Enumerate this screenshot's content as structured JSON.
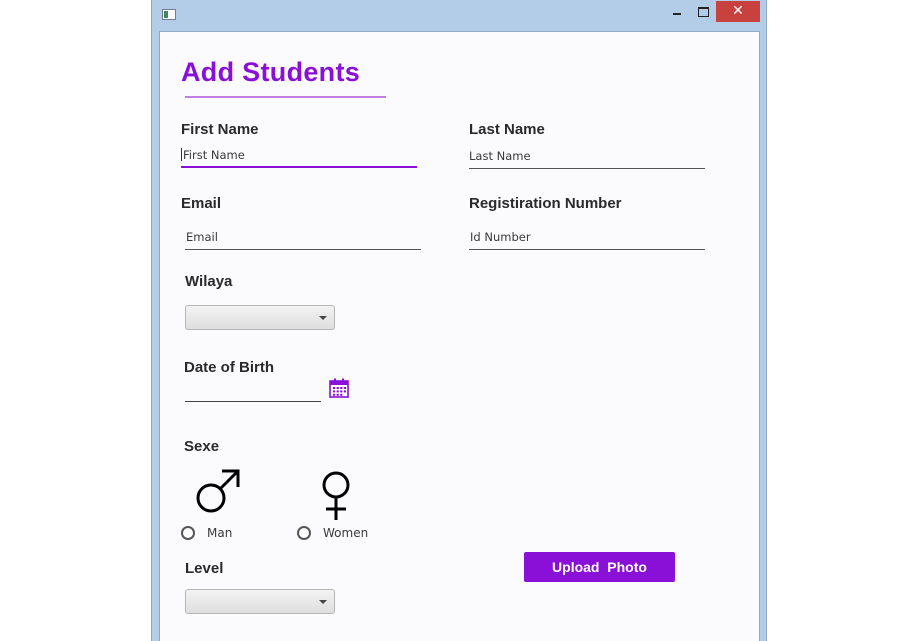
{
  "window": {
    "controls": {
      "minimize": "",
      "maximize": "",
      "close": "✕"
    }
  },
  "form": {
    "title": "Add Students",
    "first_name": {
      "label": "First Name",
      "placeholder": "First Name"
    },
    "last_name": {
      "label": "Last Name",
      "placeholder": "Last Name"
    },
    "email": {
      "label": "Email",
      "placeholder": "Email"
    },
    "registration": {
      "label": "Registiration Number",
      "placeholder": "Id Number"
    },
    "wilaya": {
      "label": "Wilaya",
      "value": ""
    },
    "date_of_birth": {
      "label": "Date of Birth",
      "value": ""
    },
    "sexe": {
      "label": "Sexe",
      "options": [
        {
          "label": "Man",
          "icon": "male-symbol-icon",
          "selected": false
        },
        {
          "label": "Women",
          "icon": "female-symbol-icon",
          "selected": false
        }
      ]
    },
    "level": {
      "label": "Level",
      "value": ""
    },
    "upload_button": "Upload  Photo"
  },
  "colors": {
    "accent": "#8a10d8",
    "title_bar": "#b3cde8",
    "close_button": "#c7423f",
    "background": "#fbfbfe"
  }
}
